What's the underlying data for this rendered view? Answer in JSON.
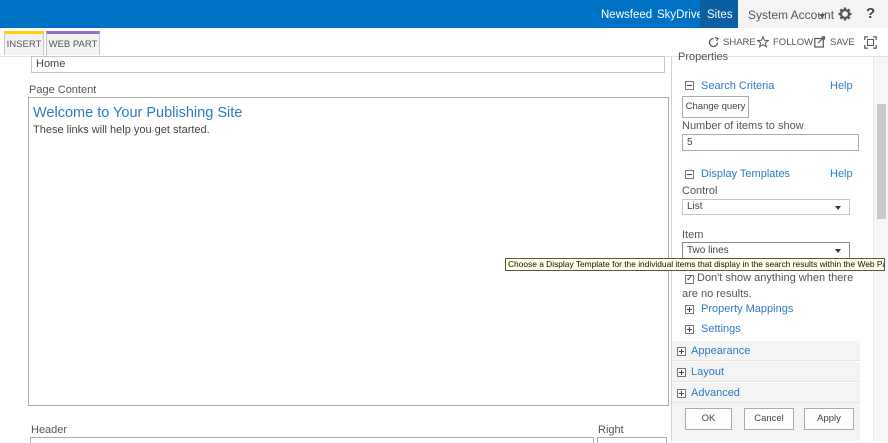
{
  "topbar": {
    "newsfeed": "Newsfeed",
    "skydrive": "SkyDrive",
    "sites": "Sites",
    "account": "System Account",
    "help": "?"
  },
  "ribbon": {
    "insert": "INSERT",
    "web_part": "WEB PART",
    "share": "SHARE",
    "follow": "FOLLOW",
    "save": "SAVE"
  },
  "page": {
    "title_value": "Home",
    "page_content_label": "Page Content",
    "welcome_heading": "Welcome to Your Publishing Site",
    "welcome_text": "These links will help you get started.",
    "header_label": "Header",
    "right_label": "Right"
  },
  "panel": {
    "properties": "Properties",
    "search_criteria": "Search Criteria",
    "help1": "Help",
    "change_query": "Change query",
    "num_items_label": "Number of items to show",
    "num_items_value": "5",
    "display_templates": "Display Templates",
    "help2": "Help",
    "control_label": "Control",
    "control_value": "List",
    "item_label": "Item",
    "item_value": "Two lines",
    "dont_show": "Don't show anything when there",
    "dont_show_2": "are no results.",
    "property_mappings": "Property Mappings",
    "settings": "Settings",
    "appearance": "Appearance",
    "layout": "Layout",
    "advanced": "Advanced",
    "ok": "OK",
    "cancel": "Cancel",
    "apply": "Apply"
  },
  "tooltip": "Choose a Display Template for the individual items that display in the search results within the Web Part.",
  "colors": {
    "suite_bar": "#0072c6",
    "link_blue": "#2d7bc4",
    "tooltip_bg": "#ffffe1"
  }
}
